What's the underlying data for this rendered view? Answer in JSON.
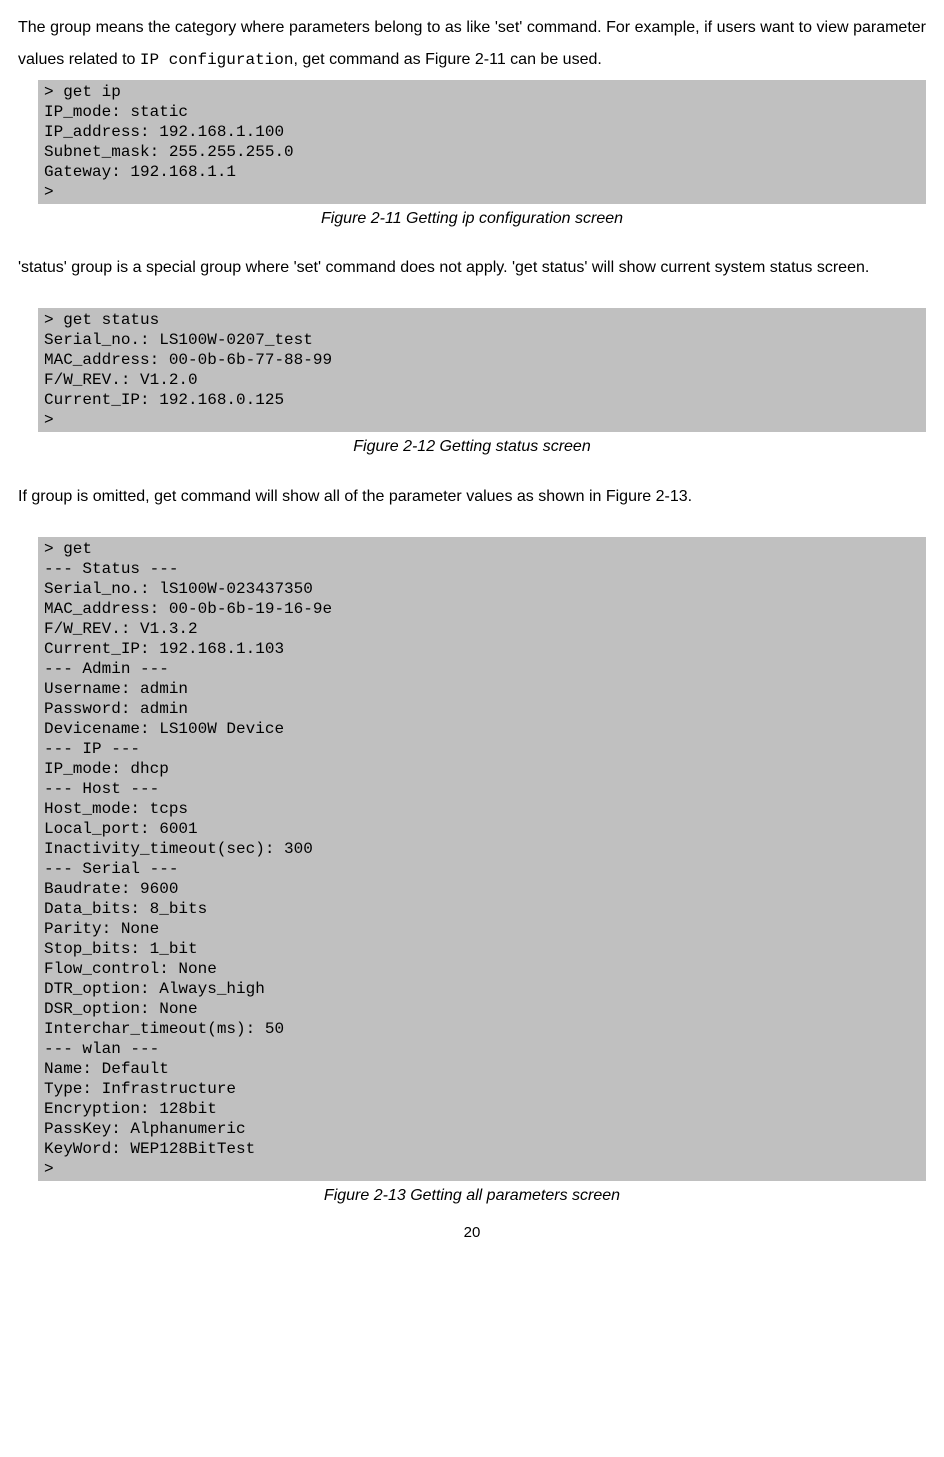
{
  "para1_a": "The group means the category where parameters belong to as like 'set' command. For example, if users want to view parameter values related to ",
  "para1_mono": "IP configuration",
  "para1_b": ", get command as Figure 2-11 can be used.",
  "code1": "> get ip\nIP_mode: static\nIP_address: 192.168.1.100\nSubnet_mask: 255.255.255.0\nGateway: 192.168.1.1\n>",
  "caption1": "Figure 2-11 Getting ip configuration screen",
  "para2": "'status' group is a special group where 'set' command does not apply. 'get status' will show current system status screen.",
  "code2": "> get status\nSerial_no.: LS100W-0207_test\nMAC_address: 00-0b-6b-77-88-99\nF/W_REV.: V1.2.0\nCurrent_IP: 192.168.0.125\n>",
  "caption2": "Figure 2-12 Getting status screen",
  "para3": "If group is omitted, get command will show all of the parameter values as shown in Figure 2-13.",
  "code3": "> get\n--- Status ---\nSerial_no.: lS100W-023437350\nMAC_address: 00-0b-6b-19-16-9e\nF/W_REV.: V1.3.2\nCurrent_IP: 192.168.1.103\n--- Admin ---\nUsername: admin\nPassword: admin\nDevicename: LS100W Device\n--- IP ---\nIP_mode: dhcp\n--- Host ---\nHost_mode: tcps\nLocal_port: 6001\nInactivity_timeout(sec): 300\n--- Serial ---\nBaudrate: 9600\nData_bits: 8_bits\nParity: None\nStop_bits: 1_bit\nFlow_control: None\nDTR_option: Always_high\nDSR_option: None\nInterchar_timeout(ms): 50\n--- wlan ---\nName: Default\nType: Infrastructure\nEncryption: 128bit\nPassKey: Alphanumeric\nKeyWord: WEP128BitTest\n>",
  "caption3": "Figure 2-13 Getting all parameters screen",
  "page_number": "20"
}
